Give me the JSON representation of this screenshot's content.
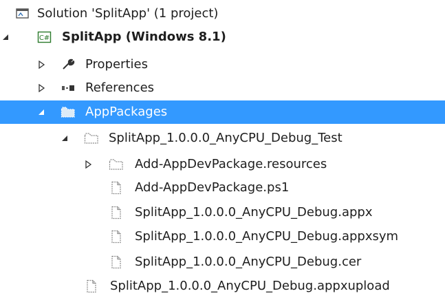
{
  "tree": {
    "solution": {
      "label": "Solution 'SplitApp' (1 project)",
      "icon": "solution-icon"
    },
    "project": {
      "label": "SplitApp (Windows 8.1)",
      "icon": "csharp-project-icon"
    },
    "properties": {
      "label": "Properties",
      "icon": "wrench-icon"
    },
    "references": {
      "label": "References",
      "icon": "references-icon"
    },
    "app_packages": {
      "label": "AppPackages",
      "icon": "folder-icon"
    },
    "debug_test": {
      "label": "SplitApp_1.0.0.0_AnyCPU_Debug_Test",
      "icon": "folder-icon"
    },
    "resources": {
      "label": "Add-AppDevPackage.resources",
      "icon": "folder-icon"
    },
    "ps1": {
      "label": "Add-AppDevPackage.ps1",
      "icon": "file-icon"
    },
    "appx": {
      "label": "SplitApp_1.0.0.0_AnyCPU_Debug.appx",
      "icon": "file-icon"
    },
    "appxsym": {
      "label": "SplitApp_1.0.0.0_AnyCPU_Debug.appxsym",
      "icon": "file-icon"
    },
    "cer": {
      "label": "SplitApp_1.0.0.0_AnyCPU_Debug.cer",
      "icon": "file-icon"
    },
    "appxupload": {
      "label": "SplitApp_1.0.0.0_AnyCPU_Debug.appxupload",
      "icon": "file-icon"
    }
  },
  "colors": {
    "selection": "#3399ff",
    "csharp_badge": "#2b7a2b"
  }
}
